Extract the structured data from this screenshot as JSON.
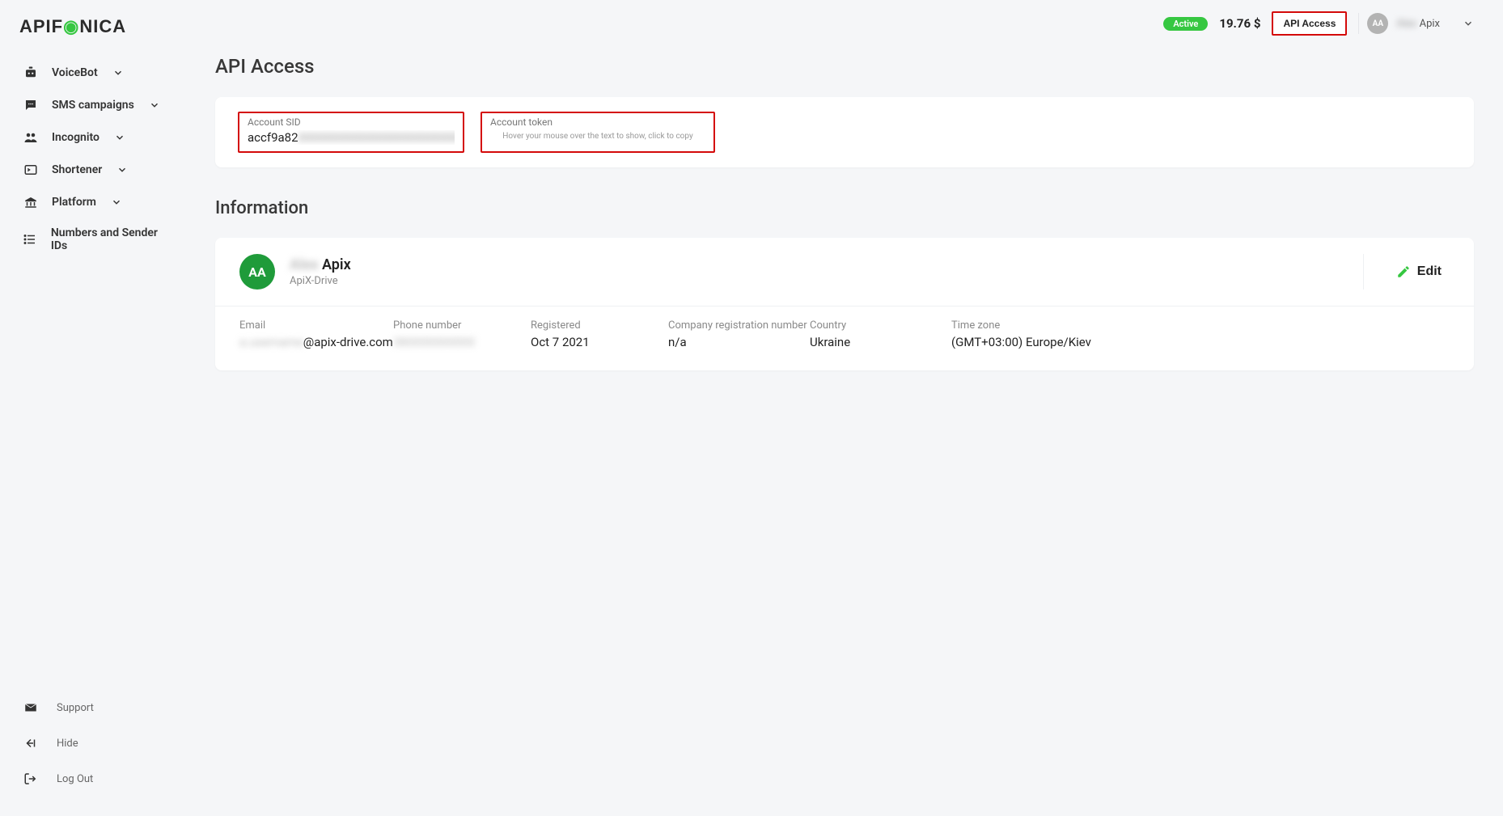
{
  "brand": {
    "name_pre": "APIF",
    "name_post": "NICA"
  },
  "sidebar": {
    "items": [
      {
        "label": "VoiceBot",
        "expandable": true
      },
      {
        "label": "SMS campaigns",
        "expandable": true
      },
      {
        "label": "Incognito",
        "expandable": true
      },
      {
        "label": "Shortener",
        "expandable": true
      },
      {
        "label": "Platform",
        "expandable": true
      },
      {
        "label": "Numbers and Sender IDs",
        "expandable": false
      }
    ],
    "bottom": [
      {
        "label": "Support"
      },
      {
        "label": "Hide"
      },
      {
        "label": "Log Out"
      }
    ]
  },
  "topbar": {
    "status": "Active",
    "balance": "19.76 $",
    "api_btn": "API Access",
    "avatar_initials": "AA",
    "user_first_blur": "Alex",
    "user_last": "Apix"
  },
  "page": {
    "title": "API Access",
    "credentials": {
      "sid_label": "Account SID",
      "sid_prefix": "accf9a82",
      "sid_blur": "0000000000000000000000000",
      "token_label": "Account token",
      "token_hover": "Hover your mouse over the text to show, click to copy"
    },
    "info_title": "Information",
    "profile": {
      "avatar_initials": "AA",
      "first_blur": "Alex",
      "last": "Apix",
      "company": "ApiX-Drive",
      "edit_label": "Edit"
    },
    "details": {
      "email_label": "Email",
      "email_prefix_blur": "a.username",
      "email_domain": "@apix-drive.com",
      "phone_label": "Phone number",
      "phone_blur": "380000000000",
      "registered_label": "Registered",
      "registered_value": "Oct 7 2021",
      "regnum_label": "Company registration number",
      "regnum_value": "n/a",
      "country_label": "Country",
      "country_value": "Ukraine",
      "tz_label": "Time zone",
      "tz_value": "(GMT+03:00) Europe/Kiev"
    }
  }
}
